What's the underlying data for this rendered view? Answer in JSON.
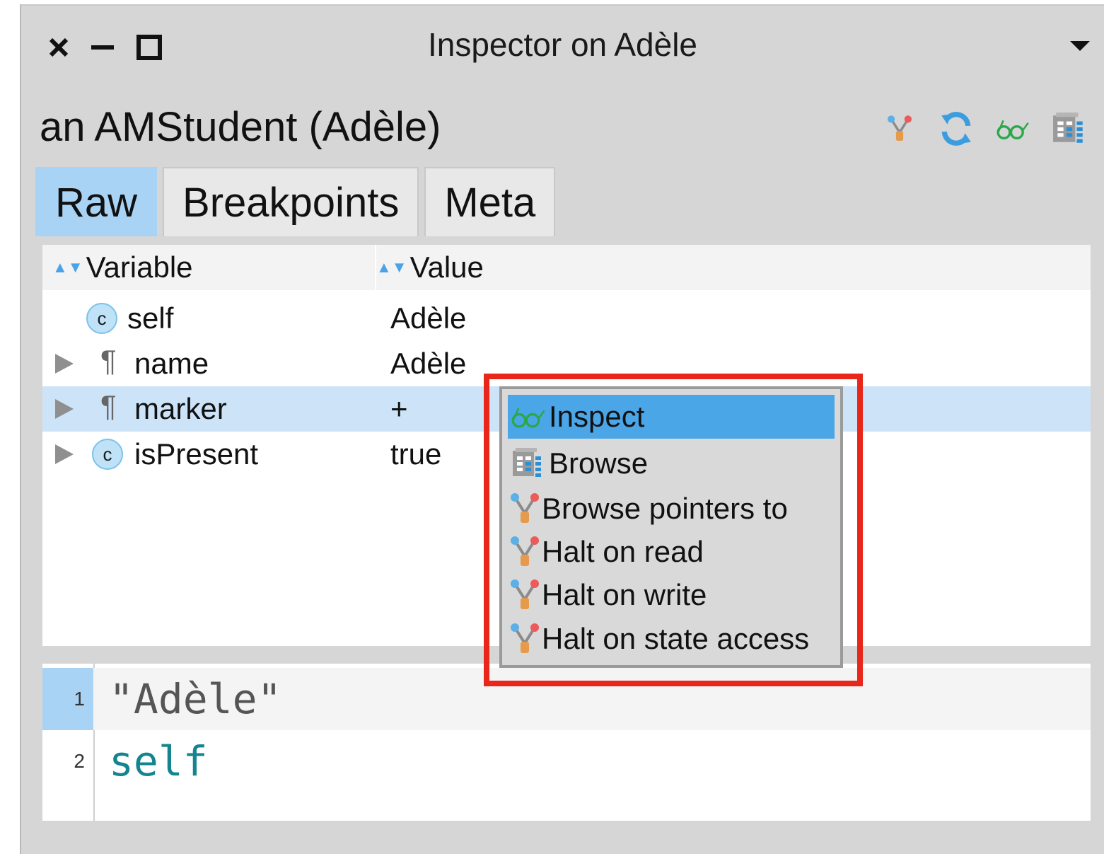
{
  "window": {
    "title": "Inspector on Adèle"
  },
  "inspector": {
    "subject": "an AMStudent (Adèle)",
    "toolbar_icons": [
      "pointers-icon",
      "refresh-icon",
      "inspect-glasses-icon",
      "browse-icon"
    ]
  },
  "tabs": [
    {
      "label": "Raw",
      "active": true
    },
    {
      "label": "Breakpoints",
      "active": false
    },
    {
      "label": "Meta",
      "active": false
    }
  ],
  "table": {
    "columns": [
      "Variable",
      "Value"
    ],
    "rows": [
      {
        "variable": "self",
        "value": "Adèle",
        "icon": "class-icon",
        "expandable": false
      },
      {
        "variable": "name",
        "value": "Adèle",
        "icon": "pilcrow-icon",
        "expandable": true
      },
      {
        "variable": "marker",
        "value": "+",
        "icon": "pilcrow-icon",
        "expandable": true,
        "selected": true
      },
      {
        "variable": "isPresent",
        "value": "true",
        "icon": "class-icon",
        "expandable": true
      }
    ]
  },
  "context_menu": {
    "items": [
      {
        "label": "Inspect",
        "icon": "inspect-glasses-icon",
        "selected": true
      },
      {
        "label": "Browse",
        "icon": "browse-icon"
      },
      {
        "label": "Browse pointers to",
        "icon": "pointers-icon"
      },
      {
        "label": "Halt on read",
        "icon": "breakpoint-icon"
      },
      {
        "label": "Halt on write",
        "icon": "breakpoint-icon"
      },
      {
        "label": "Halt on state access",
        "icon": "breakpoint-icon"
      }
    ]
  },
  "editor": {
    "lines": [
      {
        "number": "1",
        "text": "\"Adèle\""
      },
      {
        "number": "2",
        "text": "self"
      }
    ]
  },
  "colors": {
    "window_bg": "#d6d6d6",
    "tab_active": "#a9d3f5",
    "selection": "#cde4f8",
    "menu_selected": "#4ba6e8",
    "highlight_box": "#e8261a",
    "code_keyword": "#13858e"
  }
}
